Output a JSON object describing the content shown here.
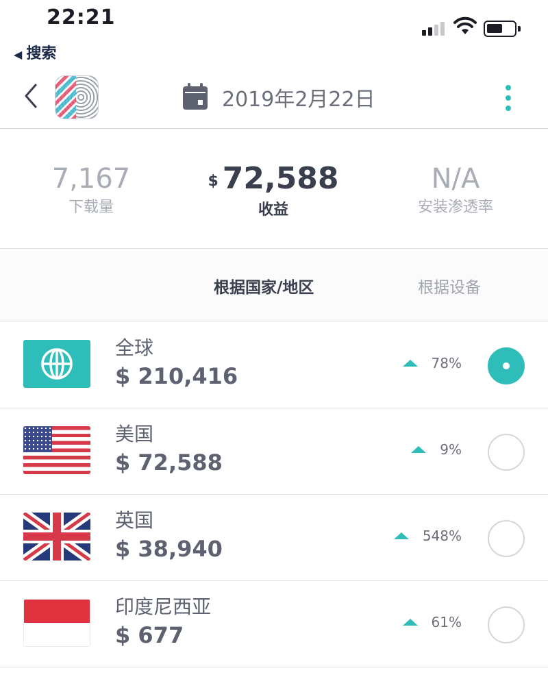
{
  "status_bar": {
    "time": "22:21",
    "back_app": "搜索",
    "back_app_arrow": "◀"
  },
  "header": {
    "date": "2019年2月22日",
    "icons": [
      "back-chevron-icon",
      "calendar-icon",
      "more-vertical-icon"
    ]
  },
  "metrics": [
    {
      "value": "7,167",
      "label": "下载量"
    },
    {
      "currency": "$",
      "value": "72,588",
      "label": "收益"
    },
    {
      "value": "N/A",
      "label": "安装渗透率"
    }
  ],
  "tabs": {
    "by_country": "根据国家/地区",
    "by_device": "根据设备"
  },
  "rows": [
    {
      "name": "全球",
      "amount": "$ 210,416",
      "change": "78%",
      "trend": "up",
      "selected": true,
      "flag": "globe-icon"
    },
    {
      "name": "美国",
      "amount": "$ 72,588",
      "change": "9%",
      "trend": "up",
      "selected": false,
      "flag": "us-flag"
    },
    {
      "name": "英国",
      "amount": "$ 38,940",
      "change": "548%",
      "trend": "up",
      "selected": false,
      "flag": "uk-flag"
    },
    {
      "name": "印度尼西亚",
      "amount": "$ 677",
      "change": "61%",
      "trend": "up",
      "selected": false,
      "flag": "indonesia-flag"
    }
  ],
  "colors": {
    "accent": "#2fbdb9",
    "text_dark": "#3a3f4e",
    "text_muted": "#a8acb4"
  }
}
